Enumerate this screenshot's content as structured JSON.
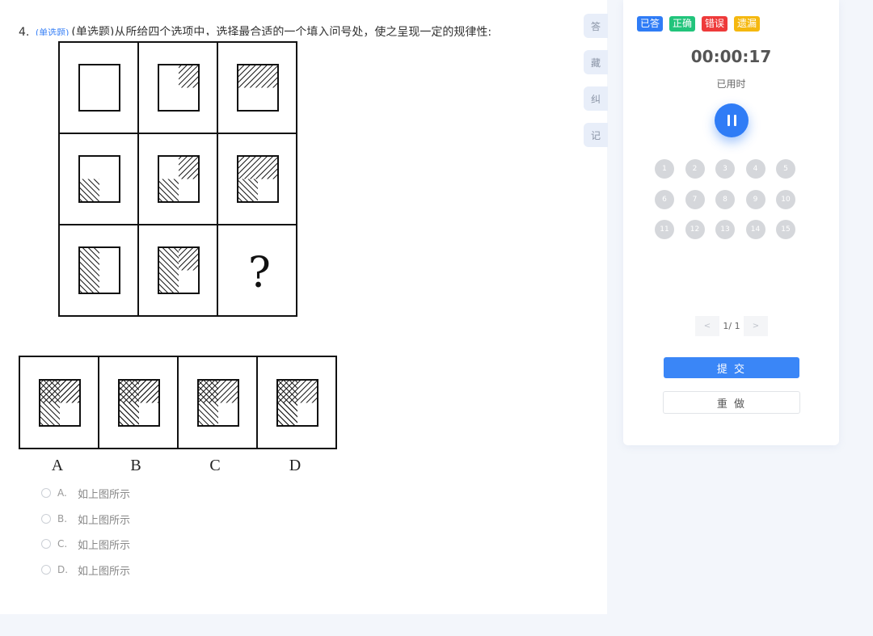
{
  "question": {
    "number": "4.",
    "type_tag": "(单选题)",
    "text": "(单选题)从所给四个选项中，选择最合适的一个填入问号处，使之呈现一定的规律性:",
    "figure": {
      "question_mark": "?",
      "option_labels": [
        "A",
        "B",
        "C",
        "D"
      ]
    },
    "options": [
      {
        "letter": "A.",
        "text": "如上图所示"
      },
      {
        "letter": "B.",
        "text": "如上图所示"
      },
      {
        "letter": "C.",
        "text": "如上图所示"
      },
      {
        "letter": "D.",
        "text": "如上图所示"
      }
    ]
  },
  "side_tabs": [
    "答",
    "藏",
    "纠",
    "记"
  ],
  "panel": {
    "legend": [
      {
        "label": "已答",
        "color": "#2f7cf6"
      },
      {
        "label": "正确",
        "color": "#21c47b"
      },
      {
        "label": "错误",
        "color": "#ee3a3a"
      },
      {
        "label": "遗漏",
        "color": "#f5b80f"
      }
    ],
    "timer": "00:00:17",
    "timer_label": "已用时",
    "numbers": [
      "1",
      "2",
      "3",
      "4",
      "5",
      "6",
      "7",
      "8",
      "9",
      "10",
      "11",
      "12",
      "13",
      "14",
      "15"
    ],
    "pager": {
      "prev": "<",
      "page": "1/ 1",
      "next": ">"
    },
    "submit_label": "提 交",
    "redo_label": "重 做"
  }
}
